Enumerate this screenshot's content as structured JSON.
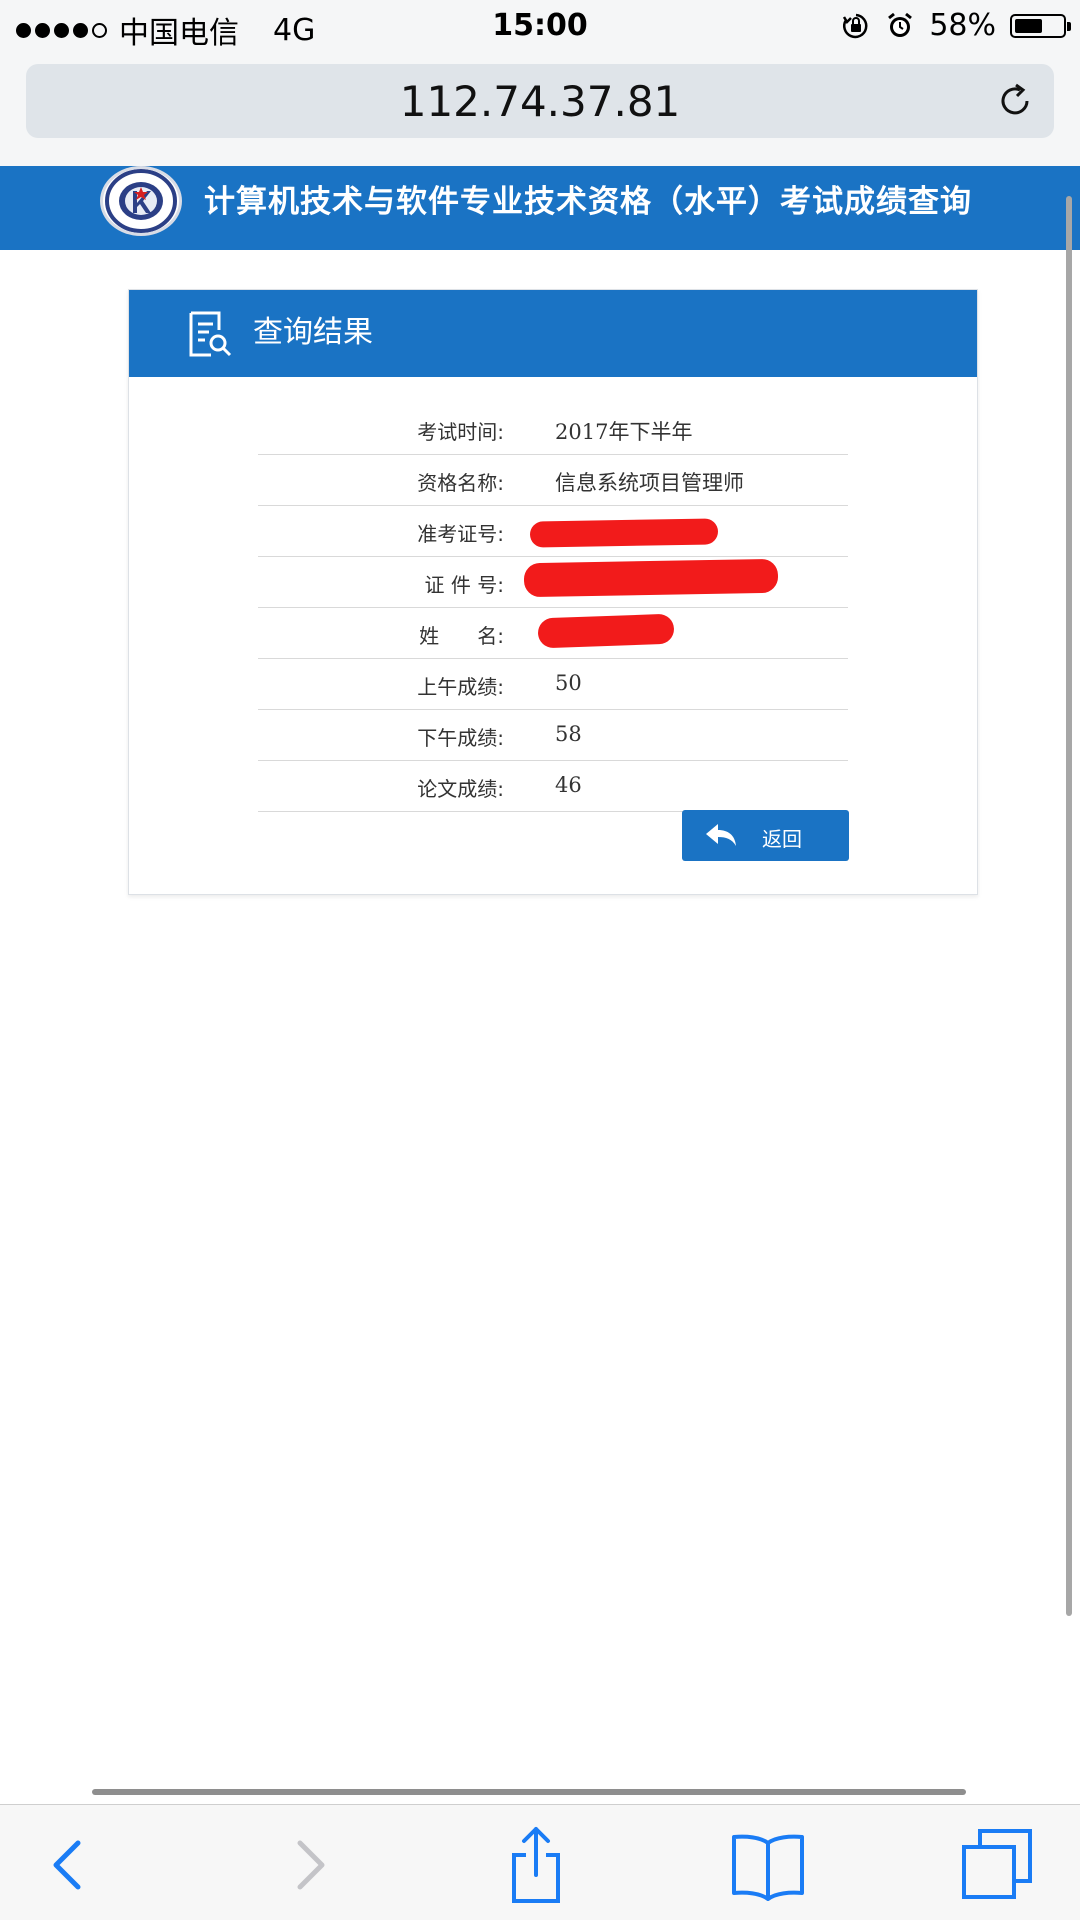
{
  "status_bar": {
    "signal_dots": 5,
    "signal_filled": 4,
    "carrier": "中国电信",
    "network": "4G",
    "time": "15:00",
    "battery_percent": "58%",
    "battery_level": 0.58,
    "icons": [
      "orientation-lock-icon",
      "alarm-icon",
      "battery-icon"
    ]
  },
  "browser": {
    "url": "112.74.37.81",
    "reload_icon": "reload-icon"
  },
  "header": {
    "title": "计算机技术与软件专业技术资格（水平）考试成绩查询",
    "logo": "ceiaec-logo"
  },
  "card": {
    "title": "查询结果",
    "title_icon": "document-search-icon",
    "rows": [
      {
        "label": "考试时间:",
        "value": "2017年下半年"
      },
      {
        "label": "资格名称:",
        "value": "信息系统项目管理师"
      },
      {
        "label": "准考证号:",
        "value": ""
      },
      {
        "label": "证 件 号:",
        "value": ""
      },
      {
        "label": "姓      名:",
        "value": ""
      },
      {
        "label": "上午成绩:",
        "value": "50"
      },
      {
        "label": "下午成绩:",
        "value": "58"
      },
      {
        "label": "论文成绩:",
        "value": "46"
      }
    ],
    "back_button": "返回",
    "back_icon": "reply-arrow-icon"
  },
  "toolbar": {
    "buttons": [
      "back-icon",
      "forward-icon",
      "share-icon",
      "bookmarks-icon",
      "tabs-icon"
    ]
  },
  "colors": {
    "brand_blue": "#1a73c4",
    "redaction_red": "#f21b1b",
    "ios_blue": "#1a7cf5"
  }
}
